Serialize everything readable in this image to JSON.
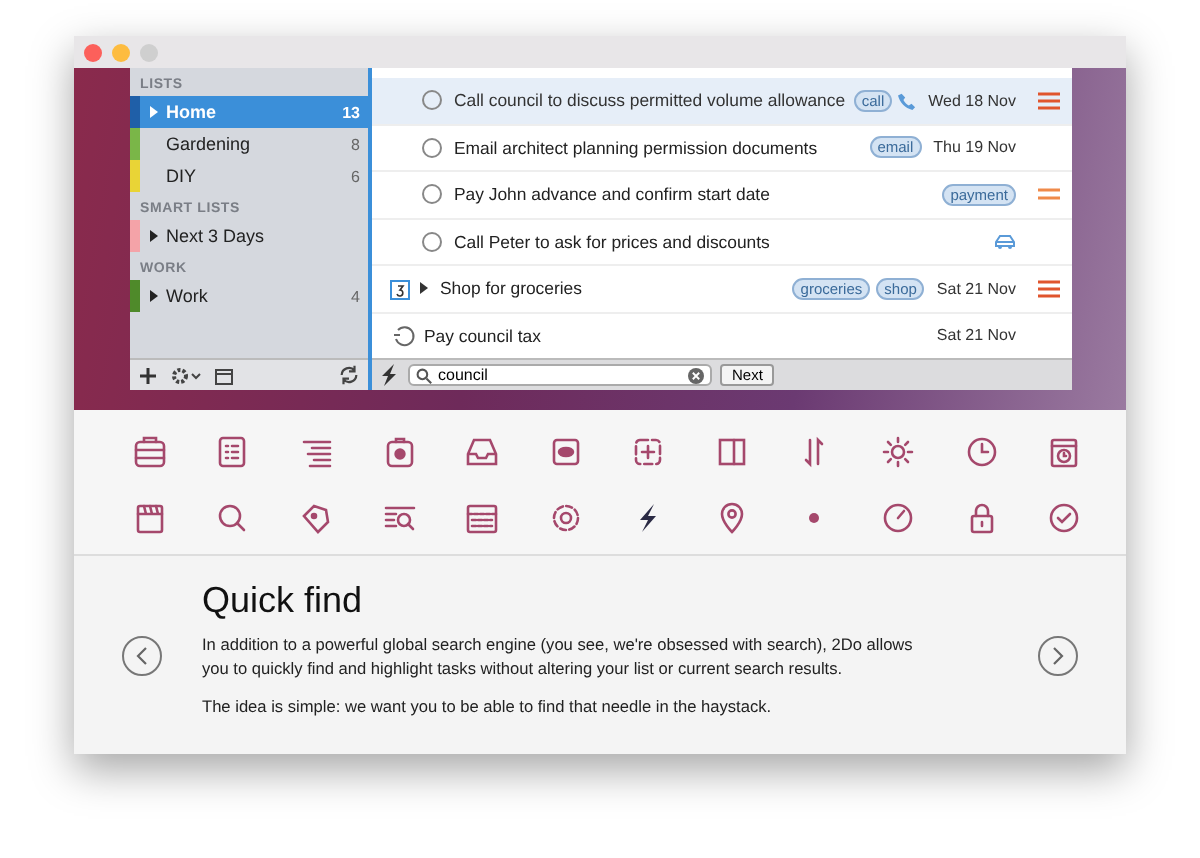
{
  "sidebar": {
    "sections": [
      {
        "title": "LISTS",
        "items": [
          {
            "label": "Home",
            "count": "13",
            "color": "#1f5fa8",
            "selected": true,
            "expandable": true
          },
          {
            "label": "Gardening",
            "count": "8",
            "color": "#7ab648",
            "selected": false,
            "expandable": false
          },
          {
            "label": "DIY",
            "count": "6",
            "color": "#e9d436",
            "selected": false,
            "expandable": false
          }
        ]
      },
      {
        "title": "SMART LISTS",
        "items": [
          {
            "label": "Next 3 Days",
            "color": "#f4a3a8",
            "selected": false,
            "expandable": true
          }
        ]
      },
      {
        "title": "WORK",
        "items": [
          {
            "label": "Work",
            "count": "4",
            "color": "#4f8a2a",
            "selected": false,
            "expandable": true
          }
        ]
      }
    ]
  },
  "tasks": [
    {
      "kind": "task",
      "title": "Call council to discuss permitted volume allowance",
      "tags": [
        "call"
      ],
      "call_action": true,
      "travel_action": false,
      "date": "Wed 18 Nov",
      "high_priority": true,
      "medium_priority": false,
      "selected": true
    },
    {
      "kind": "task",
      "title": "Email architect planning permission documents",
      "tags": [
        "email"
      ],
      "call_action": false,
      "travel_action": false,
      "date": "Thu 19 Nov",
      "high_priority": false,
      "medium_priority": false,
      "selected": false
    },
    {
      "kind": "task",
      "title": "Pay John advance and confirm start date",
      "tags": [
        "payment"
      ],
      "call_action": false,
      "travel_action": false,
      "high_priority": false,
      "medium_priority": true,
      "selected": false
    },
    {
      "kind": "task",
      "title": "Call Peter to ask for prices and discounts",
      "call_action": false,
      "travel_action": true,
      "high_priority": false,
      "medium_priority": false,
      "selected": false
    },
    {
      "kind": "project",
      "title": "Shop for groceries",
      "tags": [
        "groceries",
        "shop"
      ],
      "call_action": false,
      "travel_action": false,
      "date": "Sat 21 Nov",
      "high_priority": true,
      "medium_priority": false,
      "selected": false
    },
    {
      "kind": "recurring",
      "title": "Pay council tax",
      "call_action": false,
      "travel_action": false,
      "date": "Sat 21 Nov",
      "high_priority": false,
      "medium_priority": false,
      "selected": false
    }
  ],
  "find_bar": {
    "value": "council",
    "button": "Next"
  },
  "feature": {
    "title": "Quick find",
    "paragraphs": [
      "In addition to a powerful global search engine (you see, we're obsessed with search), 2Do allows you to quickly find and highlight tasks without altering your list or current search results.",
      "The idea is simple: we want you to be able to find that needle in the haystack."
    ]
  }
}
